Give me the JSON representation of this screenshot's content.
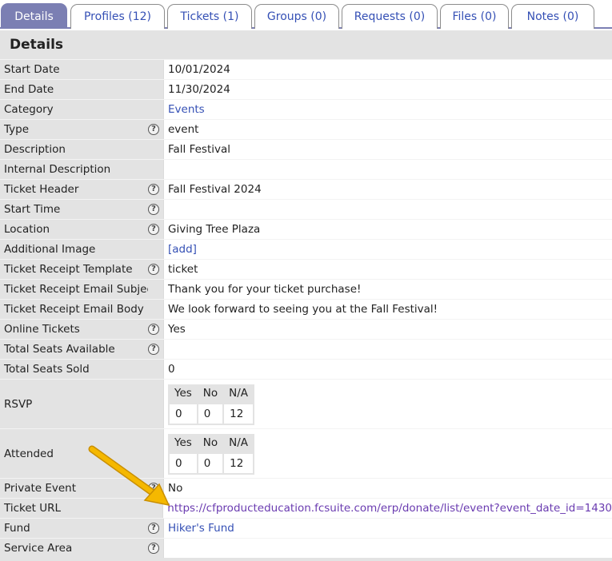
{
  "tabs": [
    {
      "label": "Details",
      "active": true
    },
    {
      "label": "Profiles (12)"
    },
    {
      "label": "Tickets (1)"
    },
    {
      "label": "Groups (0)"
    },
    {
      "label": "Requests (0)"
    },
    {
      "label": "Files (0)"
    },
    {
      "label": "Notes (0)"
    }
  ],
  "panel": {
    "title": "Details"
  },
  "rows": [
    {
      "label": "Start Date",
      "value": "10/01/2024"
    },
    {
      "label": "End Date",
      "value": "11/30/2024"
    },
    {
      "label": "Category",
      "value": "Events"
    },
    {
      "label": "Type",
      "value": "event"
    },
    {
      "label": "Description",
      "value": "Fall Festival"
    },
    {
      "label": "Internal Description",
      "value": ""
    },
    {
      "label": "Ticket Header",
      "value": "Fall Festival 2024"
    },
    {
      "label": "Start Time",
      "value": ""
    },
    {
      "label": "Location",
      "value": "Giving Tree Plaza"
    },
    {
      "label": "Additional Image",
      "value": "[add]"
    },
    {
      "label": "Ticket Receipt Template",
      "value": "ticket"
    },
    {
      "label": "Ticket Receipt Email Subject",
      "value": "Thank you for your ticket purchase!"
    },
    {
      "label": "Ticket Receipt Email Body",
      "value": "We look forward to seeing you at the Fall Festival!"
    },
    {
      "label": "Online Tickets",
      "value": "Yes"
    },
    {
      "label": "Total Seats Available",
      "value": ""
    },
    {
      "label": "Total Seats Sold",
      "value": "0"
    },
    {
      "label": "RSVP",
      "headers": [
        "Yes",
        "No",
        "N/A"
      ],
      "counts": [
        "0",
        "0",
        "12"
      ]
    },
    {
      "label": "Attended",
      "headers": [
        "Yes",
        "No",
        "N/A"
      ],
      "counts": [
        "0",
        "0",
        "12"
      ]
    },
    {
      "label": "Private Event",
      "value": "No"
    },
    {
      "label": "Ticket URL",
      "value": "https://cfproducteducation.fcsuite.com/erp/donate/list/event?event_date_id=1430"
    },
    {
      "label": "Fund",
      "value": "Hiker's Fund"
    },
    {
      "label": "Service Area",
      "value": ""
    }
  ],
  "help_icon": {
    "glyph": "?"
  },
  "annotation": {
    "icon": "arrow-icon",
    "color": "#f5b800"
  }
}
